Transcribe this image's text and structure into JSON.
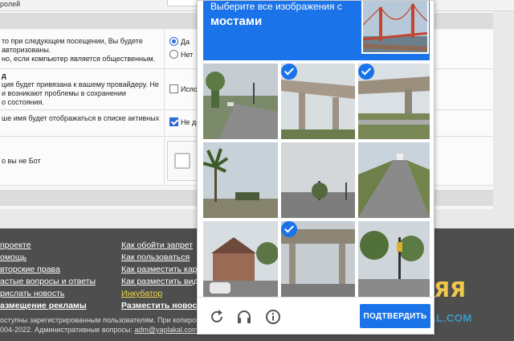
{
  "background": {
    "topbar_text": "ролей",
    "options": {
      "remember_text_1": "то при следующем посещении, Вы будете",
      "remember_text_2": "авторизованы.",
      "remember_text_3": "но, если компьютер является общественным.",
      "yes_label": "Да",
      "no_label": "Нет",
      "ip_title": "д",
      "ip_text_1": "ция будет привязана к вашему провайдеру. Не",
      "ip_text_2": "и возникают проблемы в сохранении",
      "ip_text_3": "о состояния.",
      "ip_option_label": "Испо",
      "online_text": "ше имя будет отображаться в списке активных",
      "online_option_label": "Не до",
      "bot_text": "о вы не Бот"
    },
    "footer": {
      "col1": [
        "проекте",
        "омощь",
        "вторские права",
        "астые вопросы и ответы",
        "рислать новость",
        "азмещение рекламы"
      ],
      "col2": [
        "Как обойти запрет",
        "Как пользоваться",
        "Как разместить кар",
        "Как разместить вид",
        "Инкубатор",
        "Разместить новост"
      ],
      "copy_line_1": "оступны зарегистрированным пользователям. При копировании необход",
      "copy_line_2_prefix": "004-2022. Административные вопросы: ",
      "copy_email": "adm@yaplakal.com",
      "brand_text": "PLAKAL.COM",
      "brand_mascot": "ЯЯ"
    }
  },
  "captcha": {
    "instruction": "Выберите все изображения с",
    "keyword": "мостами",
    "tiles": [
      {
        "name": "street-tile",
        "selected": false
      },
      {
        "name": "overpass-tile",
        "selected": true
      },
      {
        "name": "overpass-tile",
        "selected": true
      },
      {
        "name": "palm-tree-tile",
        "selected": false
      },
      {
        "name": "road-tile",
        "selected": false
      },
      {
        "name": "highway-tile",
        "selected": false
      },
      {
        "name": "houses-tile",
        "selected": false
      },
      {
        "name": "underpass-tile",
        "selected": true
      },
      {
        "name": "intersection-tile",
        "selected": false
      }
    ],
    "verify_label": "ПОДТВЕРДИТЬ",
    "icons": [
      "reload-icon",
      "audio-icon",
      "info-icon"
    ],
    "accent_color": "#1a73e8"
  }
}
